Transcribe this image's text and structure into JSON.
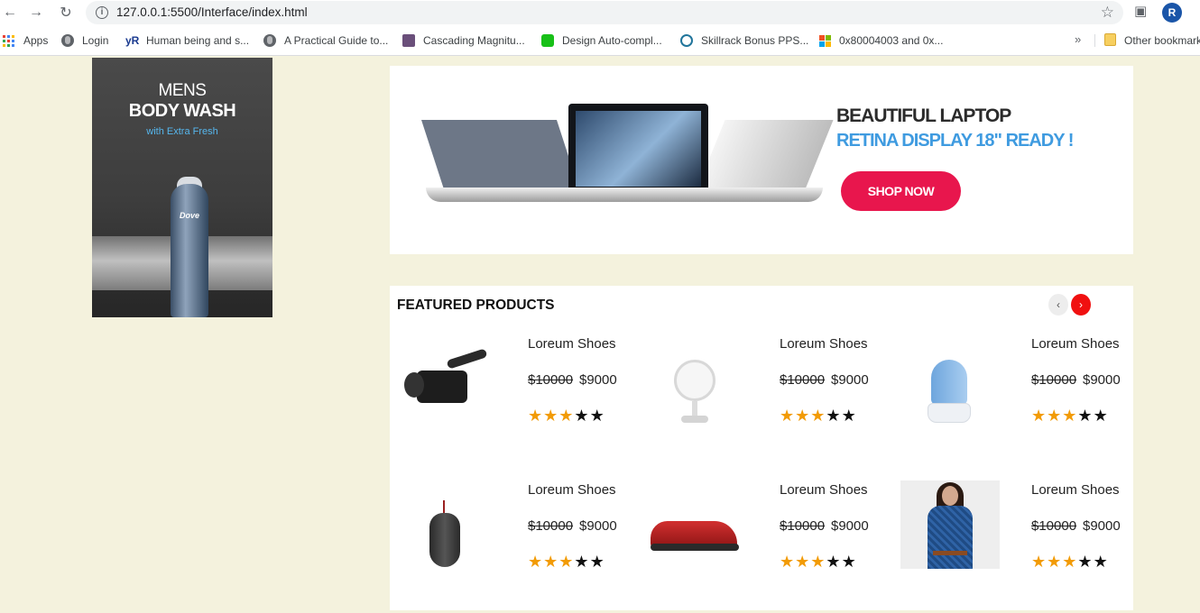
{
  "browser": {
    "url": "127.0.0.1:5500/Interface/index.html",
    "avatar_letter": "R",
    "nav_back_icon": "←",
    "nav_forward_icon": "→",
    "reload_icon": "↻",
    "star_icon": "☆"
  },
  "bookmarks": {
    "items": [
      {
        "label": "Apps",
        "icon": "apps-grid-icon"
      },
      {
        "label": "Login",
        "icon": "globe-icon"
      },
      {
        "label": "Human being and s...",
        "icon": "yr-icon"
      },
      {
        "label": "A Practical Guide to...",
        "icon": "globe-icon"
      },
      {
        "label": "Cascading Magnitu...",
        "icon": "doc-icon"
      },
      {
        "label": "Design Auto-compl...",
        "icon": "green-icon"
      },
      {
        "label": "Skillrack Bonus PPS...",
        "icon": "wordpress-icon"
      },
      {
        "label": "0x80004003 and 0x...",
        "icon": "microsoft-icon"
      }
    ],
    "overflow": "»",
    "other": "Other bookmarks"
  },
  "ad": {
    "line1": "MENS",
    "line2": "BODY WASH",
    "line3": "with Extra Fresh",
    "bottle_brand": "Dove"
  },
  "banner": {
    "line1": "BEAUTIFUL LAPTOP",
    "line2": "RETINA DISPLAY 18\" READY !",
    "button": "SHOP NOW"
  },
  "featured": {
    "title": "FEATURED PRODUCTS",
    "prev": "‹",
    "next": "›",
    "products": [
      {
        "name": "Loreum Shoes",
        "old_price": "$10000",
        "price": "$9000",
        "rating": 3,
        "max_rating": 5,
        "image": "video-camera"
      },
      {
        "name": "Loreum Shoes",
        "old_price": "$10000",
        "price": "$9000",
        "rating": 3,
        "max_rating": 5,
        "image": "desk-fan"
      },
      {
        "name": "Loreum Shoes",
        "old_price": "$10000",
        "price": "$9000",
        "rating": 3,
        "max_rating": 5,
        "image": "humidifier"
      },
      {
        "name": "Loreum Shoes",
        "old_price": "$10000",
        "price": "$9000",
        "rating": 3,
        "max_rating": 5,
        "image": "gaming-mouse"
      },
      {
        "name": "Loreum Shoes",
        "old_price": "$10000",
        "price": "$9000",
        "rating": 3,
        "max_rating": 5,
        "image": "sneaker"
      },
      {
        "name": "Loreum Shoes",
        "old_price": "$10000",
        "price": "$9000",
        "rating": 3,
        "max_rating": 5,
        "image": "dress"
      }
    ]
  },
  "colors": {
    "page_bg": "#f4f2dd",
    "star_on": "#f29b05",
    "accent": "#f01010",
    "shop_button": "#e8164d"
  }
}
